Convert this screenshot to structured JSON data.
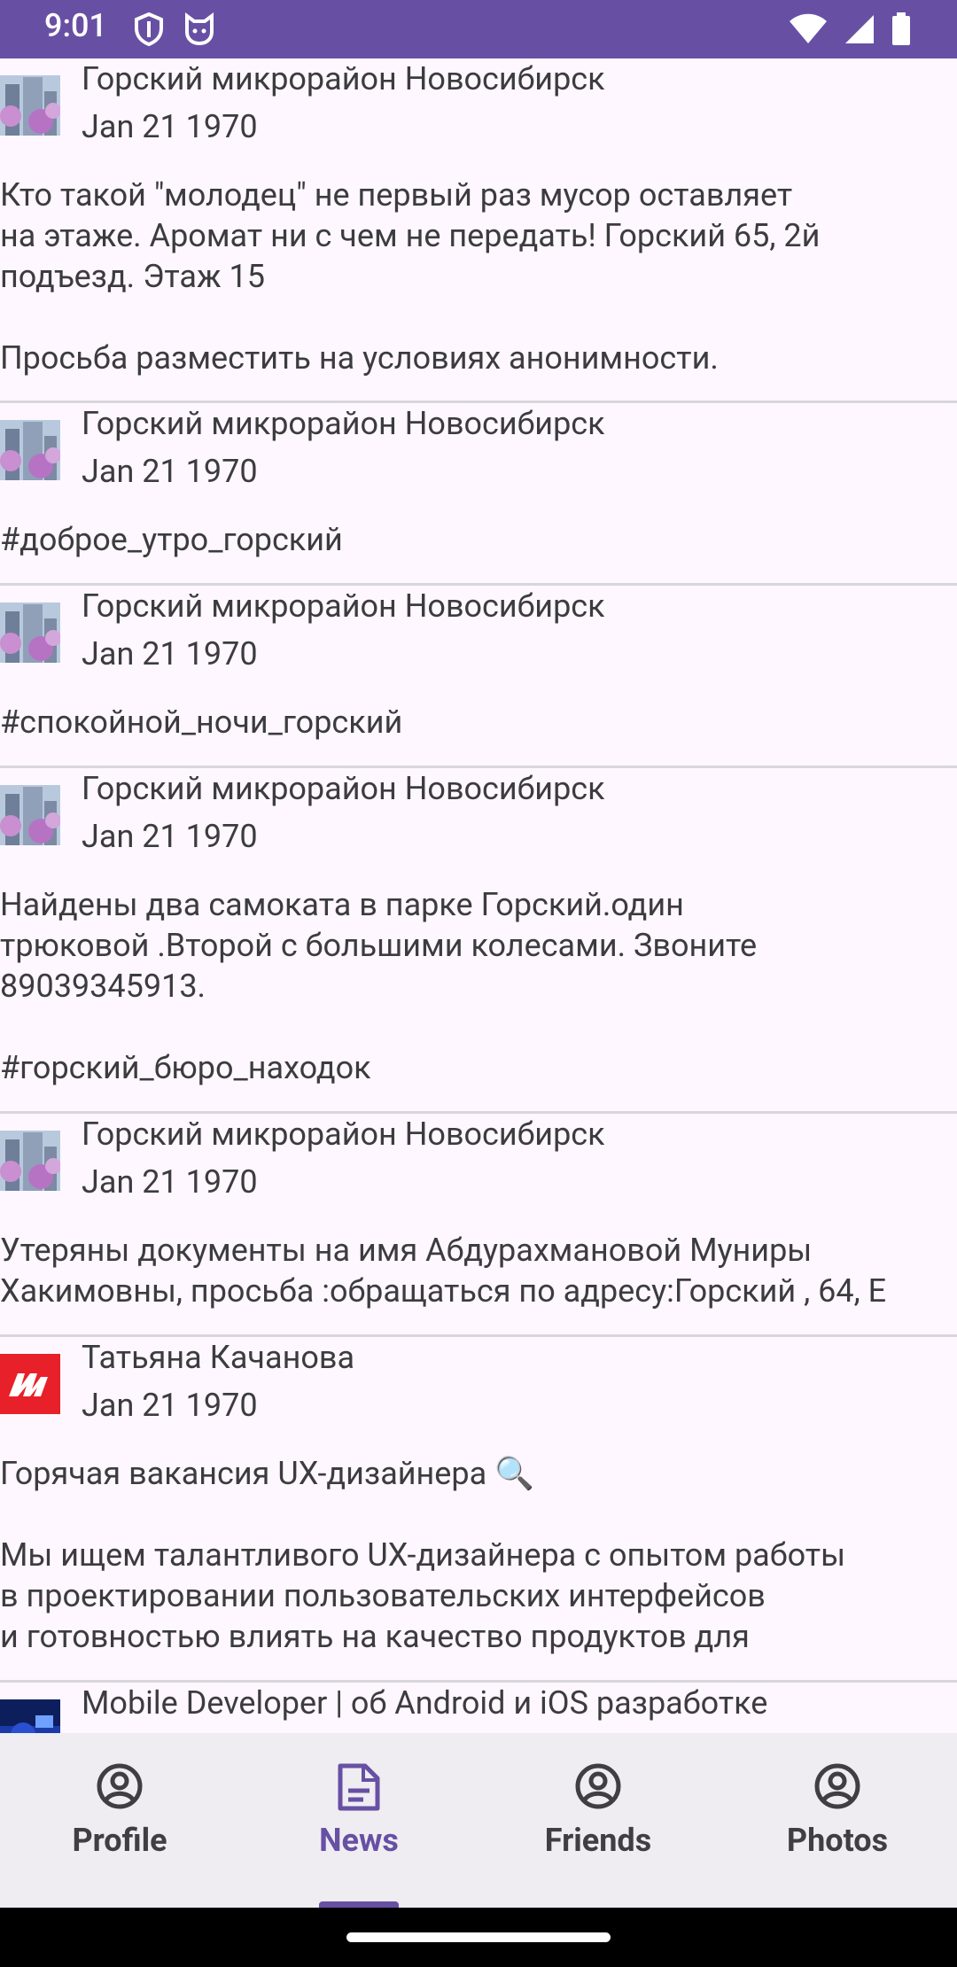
{
  "status_bar": {
    "time": "9:01",
    "left_icons": [
      "shield-icon",
      "cat-icon"
    ],
    "right_icons": [
      "wifi-icon",
      "signal-icon",
      "battery-icon"
    ]
  },
  "posts": [
    {
      "author": "Горский микрорайон Новосибирск",
      "date": "Jan 21 1970",
      "avatar": "lilac-buildings",
      "text": "Кто такой \"молодец\" не первый раз мусор оставляет\nна этаже. Аромат ни с чем не передать! Горский 65, 2й\nподъезд. Этаж 15\n\nПросьба разместить на условиях анонимности."
    },
    {
      "author": "Горский микрорайон Новосибирск",
      "date": "Jan 21 1970",
      "avatar": "lilac-buildings",
      "text": "#доброе_утро_горский"
    },
    {
      "author": "Горский микрорайон Новосибирск",
      "date": "Jan 21 1970",
      "avatar": "lilac-buildings",
      "text": "#спокойной_ночи_горский"
    },
    {
      "author": "Горский микрорайон Новосибирск",
      "date": "Jan 21 1970",
      "avatar": "lilac-buildings",
      "text": "Найдены два самоката в парке Горский.один\nтрюковой .Второй с большими колесами. Звоните\n89039345913.\n\n#горский_бюро_находок"
    },
    {
      "author": "Горский микрорайон Новосибирск",
      "date": "Jan 21 1970",
      "avatar": "lilac-buildings",
      "text": "Утеряны документы на имя Абдурахмановой Муниры\nХакимовны, просьба :обращаться по адресу:Горский , 64, Е"
    },
    {
      "author": "Татьяна Качанова",
      "date": "Jan 21 1970",
      "avatar": "red-m-logo",
      "text": "Горячая вакансия UX-дизайнера 🔍\n\nМы ищем талантливого UX-дизайнера с опытом работы\nв проектировании пользовательских интерфейсов\nи готовностью влиять на качество продуктов для"
    },
    {
      "author": "Mobile Developer | об Android и iOS разработке",
      "date": "",
      "avatar": "dev-blue",
      "text": ""
    }
  ],
  "bottom_nav": [
    {
      "label": "Profile",
      "icon": "account-circle-icon",
      "active": false
    },
    {
      "label": "News",
      "icon": "article-icon",
      "active": true
    },
    {
      "label": "Friends",
      "icon": "account-circle-icon",
      "active": false
    },
    {
      "label": "Photos",
      "icon": "account-circle-icon",
      "active": false
    }
  ],
  "colors": {
    "primary": "#6750a4",
    "background": "#fef7ff",
    "nav_background": "#efedf1",
    "text": "#3c3c3f"
  }
}
